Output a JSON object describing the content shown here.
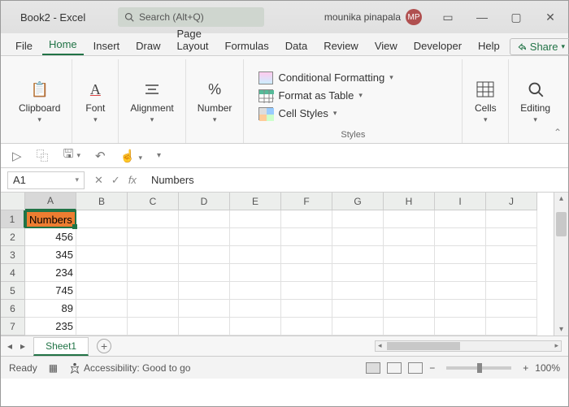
{
  "title": "Book2  -  Excel",
  "search_placeholder": "Search (Alt+Q)",
  "user_name": "mounika pinapala",
  "user_initials": "MP",
  "tabs": [
    "File",
    "Home",
    "Insert",
    "Draw",
    "Page Layout",
    "Formulas",
    "Data",
    "Review",
    "View",
    "Developer",
    "Help"
  ],
  "active_tab": "Home",
  "share_label": "Share",
  "ribbon": {
    "clipboard": "Clipboard",
    "font": "Font",
    "alignment": "Alignment",
    "number": "Number",
    "styles": "Styles",
    "cells": "Cells",
    "editing": "Editing",
    "cond_format": "Conditional Formatting",
    "format_table": "Format as Table",
    "cell_styles": "Cell Styles"
  },
  "namebox": "A1",
  "formula": "Numbers",
  "columns": [
    "A",
    "B",
    "C",
    "D",
    "E",
    "F",
    "G",
    "H",
    "I",
    "J"
  ],
  "rows": [
    {
      "n": "1",
      "a": "Numbers"
    },
    {
      "n": "2",
      "a": "456"
    },
    {
      "n": "3",
      "a": "345"
    },
    {
      "n": "4",
      "a": "234"
    },
    {
      "n": "5",
      "a": "745"
    },
    {
      "n": "6",
      "a": "89"
    },
    {
      "n": "7",
      "a": "235"
    }
  ],
  "sheet_name": "Sheet1",
  "status_ready": "Ready",
  "accessibility": "Accessibility: Good to go",
  "zoom": "100%"
}
